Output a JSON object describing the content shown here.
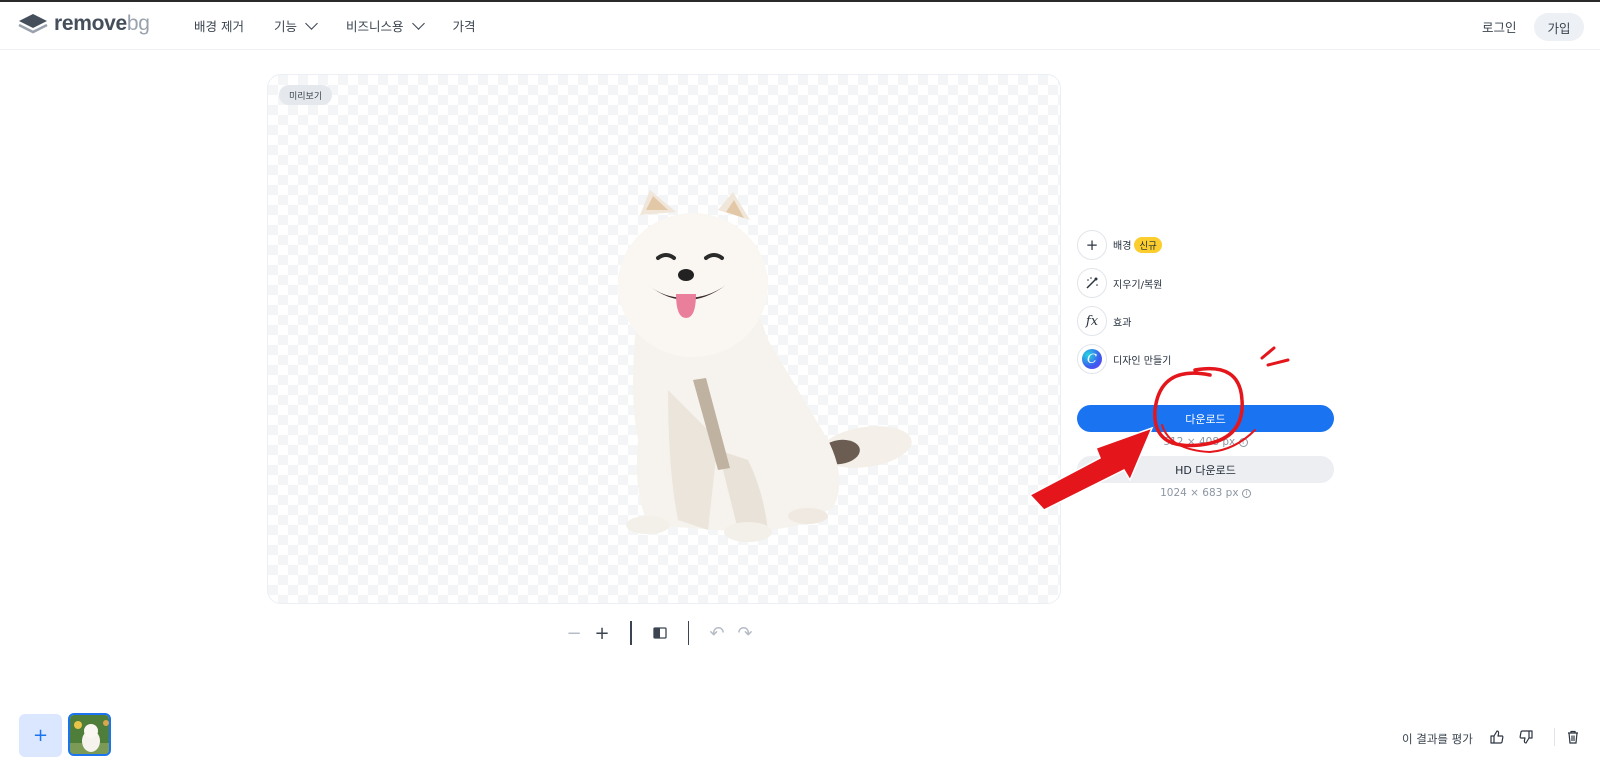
{
  "brand": {
    "logo_main": "remove",
    "logo_suffix": "bg"
  },
  "nav": {
    "items": [
      {
        "label": "배경 제거",
        "dropdown": false
      },
      {
        "label": "기능",
        "dropdown": true
      },
      {
        "label": "비즈니스용",
        "dropdown": true
      },
      {
        "label": "가격",
        "dropdown": false
      }
    ],
    "login_label": "로그인",
    "signup_label": "가입"
  },
  "canvas": {
    "badge_label": "미리보기"
  },
  "toolbar": {
    "icons": [
      "zoom-out-icon",
      "zoom-in-icon",
      "compare-icon",
      "undo-icon",
      "redo-icon"
    ],
    "disabled": [
      "zoom-out-icon",
      "undo-icon",
      "redo-icon"
    ]
  },
  "tools": {
    "background": {
      "label": "배경",
      "badge": "신규",
      "icon": "plus-icon"
    },
    "erase_restore": {
      "label": "지우기/복원",
      "icon": "brush-icon"
    },
    "effects": {
      "label": "효과",
      "icon": "fx-icon"
    },
    "design": {
      "label": "디자인 만들기",
      "icon": "canva-icon",
      "glyph": "C"
    }
  },
  "download": {
    "label": "다운로드",
    "size": "512 × 408 px",
    "hd_label": "HD 다운로드",
    "hd_size": "1024 × 683 px"
  },
  "bottom": {
    "add_label": "+",
    "rate_label": "이 결과를 평가"
  },
  "colors": {
    "accent": "#1a73f0",
    "new_badge": "#fbcd2d",
    "annotation": "#e4161b"
  }
}
